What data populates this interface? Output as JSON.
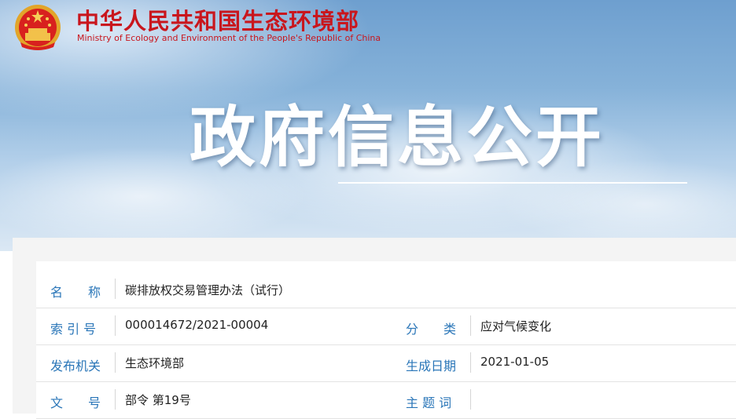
{
  "header": {
    "title_cn": "中华人民共和国生态环境部",
    "title_en": "Ministry of Ecology and Environment of the People's Republic of China"
  },
  "banner": {
    "heading": "政府信息公开"
  },
  "info": {
    "name_label": "名　　称",
    "name_value": "碳排放权交易管理办法（试行）",
    "index_label": "索 引 号",
    "index_value": "000014672/2021-00004",
    "category_label": "分　　类",
    "category_value": "应对气候变化",
    "issuer_label": "发布机关",
    "issuer_value": "生态环境部",
    "date_label": "生成日期",
    "date_value": "2021-01-05",
    "doc_no_label": "文　　号",
    "doc_no_value": "部令 第19号",
    "keywords_label": "主 题 词",
    "keywords_value": ""
  },
  "colors": {
    "brand_red": "#c9161d",
    "label_blue": "#2a76b8"
  },
  "icons": {
    "emblem": "national-emblem-icon"
  }
}
